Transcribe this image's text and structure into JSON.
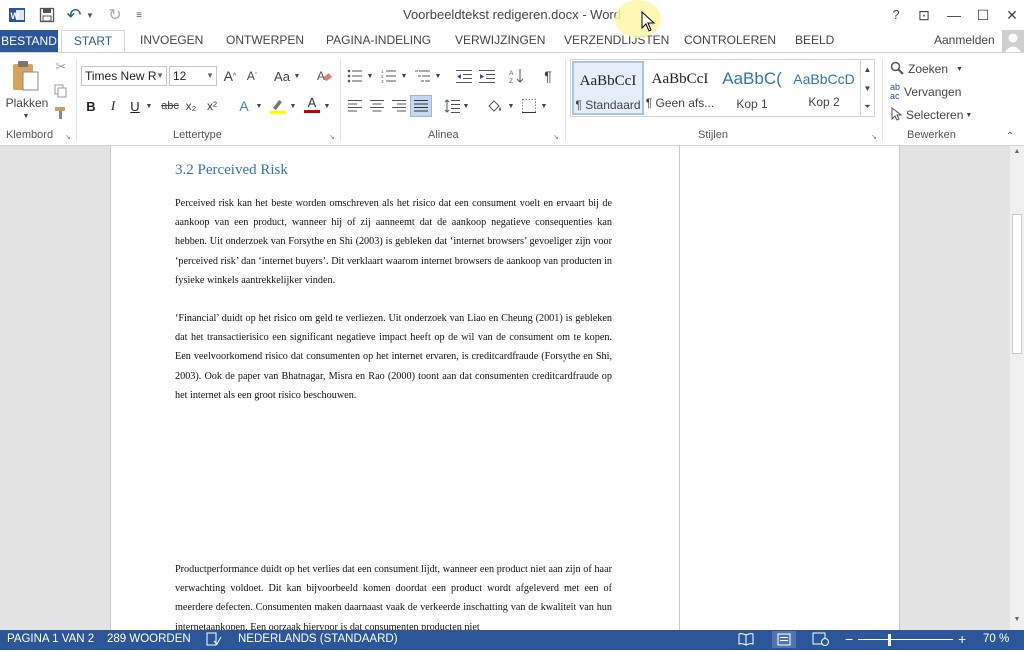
{
  "window": {
    "title": "Voorbeeldtekst redigeren.docx - Word",
    "help": "?",
    "buttons": {
      "ribbon_display": "⊡",
      "minimize": "—",
      "maximize": "☐",
      "close": "✕"
    }
  },
  "qat": {
    "undo": "↶",
    "redo": "↻",
    "customize": "⁼"
  },
  "tabs": {
    "file": "BESTAND",
    "items": [
      "START",
      "INVOEGEN",
      "ONTWERPEN",
      "PAGINA-INDELING",
      "VERWIJZINGEN",
      "VERZENDLIJSTEN",
      "CONTROLEREN",
      "BEELD"
    ],
    "signin": "Aanmelden"
  },
  "ribbon": {
    "clipboard": {
      "paste_label": "Plakken",
      "group_label": "Klembord"
    },
    "font": {
      "name": "Times New R",
      "size": "12",
      "grow": "A",
      "shrink": "A",
      "case": "Aa",
      "bold": "B",
      "italic": "I",
      "underline": "U",
      "strike": "abc",
      "subscript": "x₂",
      "superscript": "x²",
      "effects": "A",
      "color_letter": "A",
      "group_label": "Lettertype"
    },
    "paragraph": {
      "show_marks": "¶",
      "group_label": "Alinea"
    },
    "styles": {
      "items": [
        {
          "sample": "AaBbCcI",
          "name": "¶ Standaard"
        },
        {
          "sample": "AaBbCcI",
          "name": "¶ Geen afs..."
        },
        {
          "sample": "AaBbC(",
          "name": "Kop 1"
        },
        {
          "sample": "AaBbCcD",
          "name": "Kop 2"
        }
      ],
      "group_label": "Stijlen"
    },
    "editing": {
      "find": "Zoeken",
      "replace": "Vervangen",
      "select": "Selecteren",
      "group_label": "Bewerken"
    }
  },
  "document": {
    "heading": "3.2 Perceived Risk",
    "paragraphs": [
      "Perceived risk kan het beste worden omschreven als het risico dat een consument voelt en ervaart bij de aankoop van een product, wanneer hij of zij aanneemt dat de aankoop negatieve consequenties kan hebben. Uit onderzoek van Forsythe en Shi (2003) is gebleken dat ‘internet browsers’ gevoeliger zijn voor ‘perceived risk’ dan ‘internet buyers’. Dit verklaart waarom internet browsers de aankoop van producten in fysieke winkels aantrekkelijker vinden.",
      "‘Financial’ duidt op het risico om geld te verliezen. Uit onderzoek van Liao en Cheung (2001) is gebleken dat het transactierisico een significant negatieve impact heeft op de wil van de consument om te kopen. Een veelvoorkomend risico dat consumenten op het internet ervaren, is creditcardfraude (Forsythe en Shi, 2003). Ook de paper van Bhatnagar, Misra en Rao (2000) toont aan dat consumenten creditcardfraude op het internet als een groot risico beschouwen.",
      "Productperformance duidt op het verlies dat een consument lijdt, wanneer een product niet aan zijn of haar verwachting voldoet. Dit kan bijvoorbeeld komen doordat een product wordt afgeleverd met een of meerdere defecten. Consumenten maken daarnaast vaak de verkeerde inschatting van de kwaliteit van hun internetaankopen. Een oorzaak hiervoor is dat consumenten producten niet"
    ]
  },
  "status": {
    "page": "PAGINA 1 VAN 2",
    "words": "289 WOORDEN",
    "language": "NEDERLANDS (STANDAARD)",
    "zoom": "70 %",
    "zoom_minus": "−",
    "zoom_plus": "+"
  },
  "colors": {
    "accent": "#2b579a",
    "heading": "#2e74b5",
    "highlight": "#ffff00",
    "font_color": "#c00000"
  }
}
